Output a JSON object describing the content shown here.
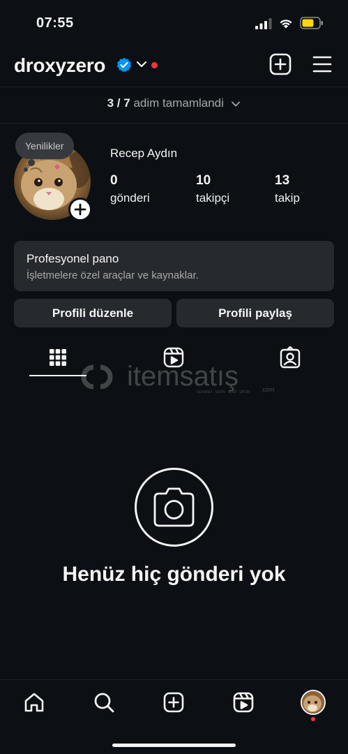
{
  "status_bar": {
    "time": "07:55"
  },
  "header": {
    "username": "droxyzero",
    "verified": true
  },
  "progress": {
    "completed": "3 / 7",
    "label": "adim tamamlandi"
  },
  "profile": {
    "note": "Yenilikler",
    "full_name": "Recep Aydın",
    "stats": [
      {
        "value": "0",
        "label": "gönderi"
      },
      {
        "value": "10",
        "label": "takipçi"
      },
      {
        "value": "13",
        "label": "takip"
      }
    ]
  },
  "pro_dashboard": {
    "title": "Profesyonel pano",
    "subtitle": "İşletmelere özel araçlar ve kaynaklar."
  },
  "actions": {
    "edit_label": "Profili düzenle",
    "share_label": "Profili paylaş"
  },
  "tabs": [
    {
      "icon": "grid-icon",
      "active": true
    },
    {
      "icon": "reels-icon",
      "active": false
    },
    {
      "icon": "tagged-icon",
      "active": false
    }
  ],
  "watermark": {
    "brand": "itemsatış",
    "tagline": "GÜVENLİ · SATIN · ALIM · SATIM",
    "suffix": ".com"
  },
  "empty_state": {
    "title": "Henüz hiç gönderi yok"
  },
  "bottom_nav": [
    "home-icon",
    "search-icon",
    "create-icon",
    "reels-icon",
    "profile-avatar"
  ],
  "colors": {
    "background": "#0c1014",
    "surface": "#262a2f",
    "verified": "#0095f6",
    "notification": "#ff3040",
    "battery": "#ffd60a"
  }
}
